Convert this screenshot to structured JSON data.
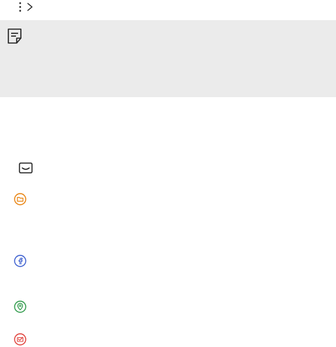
{
  "header": {
    "menu_icon": "more-vert-icon",
    "arrow_icon": "chevron-right-icon"
  },
  "note": {
    "icon": "note-icon",
    "background_color": "#ebebeb"
  },
  "app_icons": [
    {
      "name": "email-icon",
      "color": "#222222"
    },
    {
      "name": "folder-icon",
      "color": "#e8820e"
    },
    {
      "name": "facebook-icon",
      "color": "#3b5ecf"
    },
    {
      "name": "location-pin-icon",
      "color": "#2f9a4a"
    },
    {
      "name": "mail-check-icon",
      "color": "#e0403a"
    }
  ]
}
